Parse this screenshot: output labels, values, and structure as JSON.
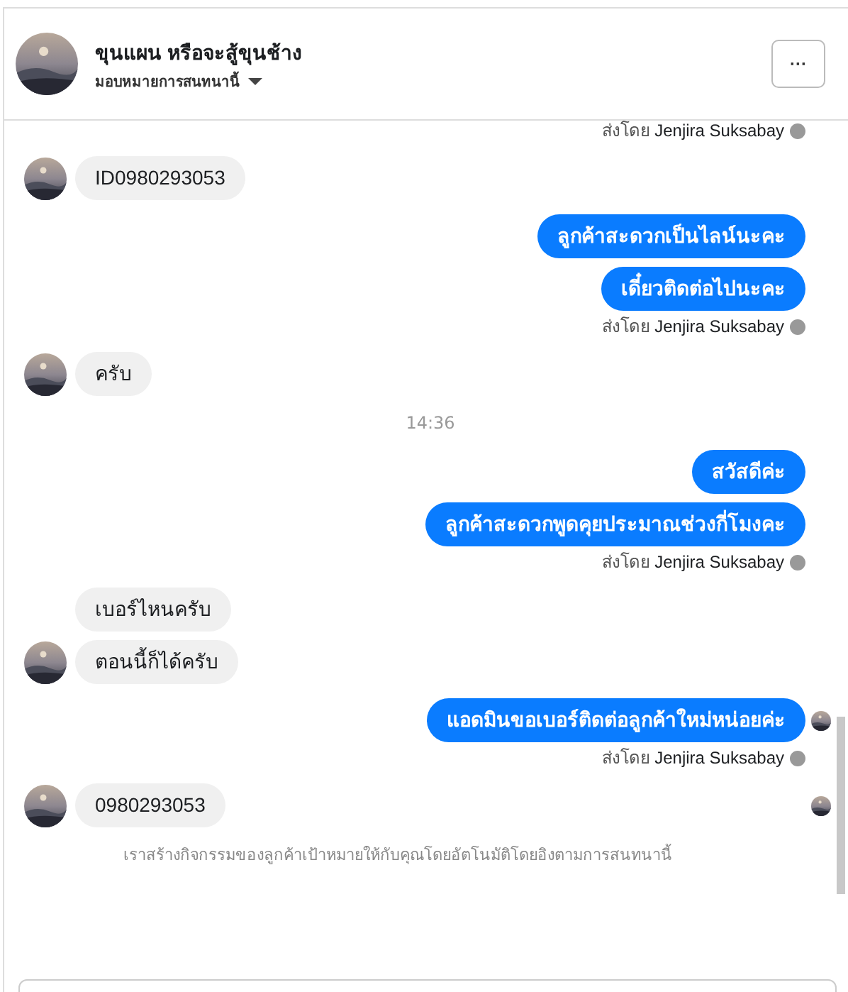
{
  "header": {
    "title": "ขุนแผน หรือจะสู้ขุนช้าง",
    "subtitle": "มอบหมายการสนทนานี้",
    "more_button": "···"
  },
  "messages": [
    {
      "kind": "sent_by",
      "prefix": "ส่งโดย",
      "name": "Jenjira Suksabay"
    },
    {
      "kind": "incoming",
      "bubbles": [
        "ID0980293053"
      ],
      "seen": false
    },
    {
      "kind": "outgoing",
      "bubbles": [
        "ลูกค้าสะดวกเป็นไลน์นะคะ",
        "เดี๋ยวติดต่อไปนะคะ"
      ],
      "seen": false
    },
    {
      "kind": "sent_by",
      "prefix": "ส่งโดย",
      "name": "Jenjira Suksabay"
    },
    {
      "kind": "incoming",
      "bubbles": [
        "ครับ"
      ],
      "seen": false
    },
    {
      "kind": "time",
      "text": "14:36"
    },
    {
      "kind": "outgoing",
      "bubbles": [
        "สวัสดีค่ะ",
        "ลูกค้าสะดวกพูดคุยประมาณช่วงกี่โมงคะ"
      ],
      "seen": false
    },
    {
      "kind": "sent_by",
      "prefix": "ส่งโดย",
      "name": "Jenjira Suksabay"
    },
    {
      "kind": "incoming",
      "bubbles": [
        "เบอร์ไหนครับ",
        "ตอนนี้ก็ได้ครับ"
      ],
      "seen": false
    },
    {
      "kind": "outgoing",
      "bubbles": [
        "แอดมินขอเบอร์ติดต่อลูกค้าใหม่หน่อยค่ะ"
      ],
      "seen": true
    },
    {
      "kind": "sent_by",
      "prefix": "ส่งโดย",
      "name": "Jenjira Suksabay"
    },
    {
      "kind": "incoming",
      "bubbles": [
        "0980293053"
      ],
      "seen": true
    },
    {
      "kind": "notice",
      "text": "เราสร้างกิจกรรมของลูกค้าเป้าหมายให้กับคุณโดยอัตโนมัติโดยอิงตามการสนทนานี้"
    }
  ]
}
